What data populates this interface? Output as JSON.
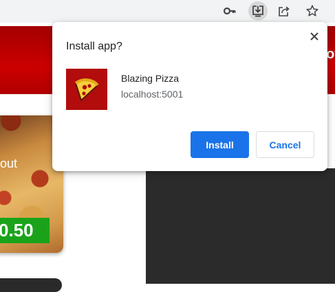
{
  "toolbar": {
    "icons": [
      "key-icon",
      "install-icon",
      "share-icon",
      "star-icon"
    ]
  },
  "page": {
    "banner_text": "ot",
    "card_text": "out",
    "price": "0.50",
    "colors": {
      "banner_red": "#cc0000",
      "price_green": "#1aa31a",
      "dark_panel": "#2b2b2b"
    }
  },
  "dialog": {
    "title": "Install app?",
    "app_name": "Blazing Pizza",
    "app_origin": "localhost:5001",
    "install_label": "Install",
    "cancel_label": "Cancel",
    "colors": {
      "install_bg": "#1a73e8",
      "icon_bg": "#b20c0c"
    }
  }
}
